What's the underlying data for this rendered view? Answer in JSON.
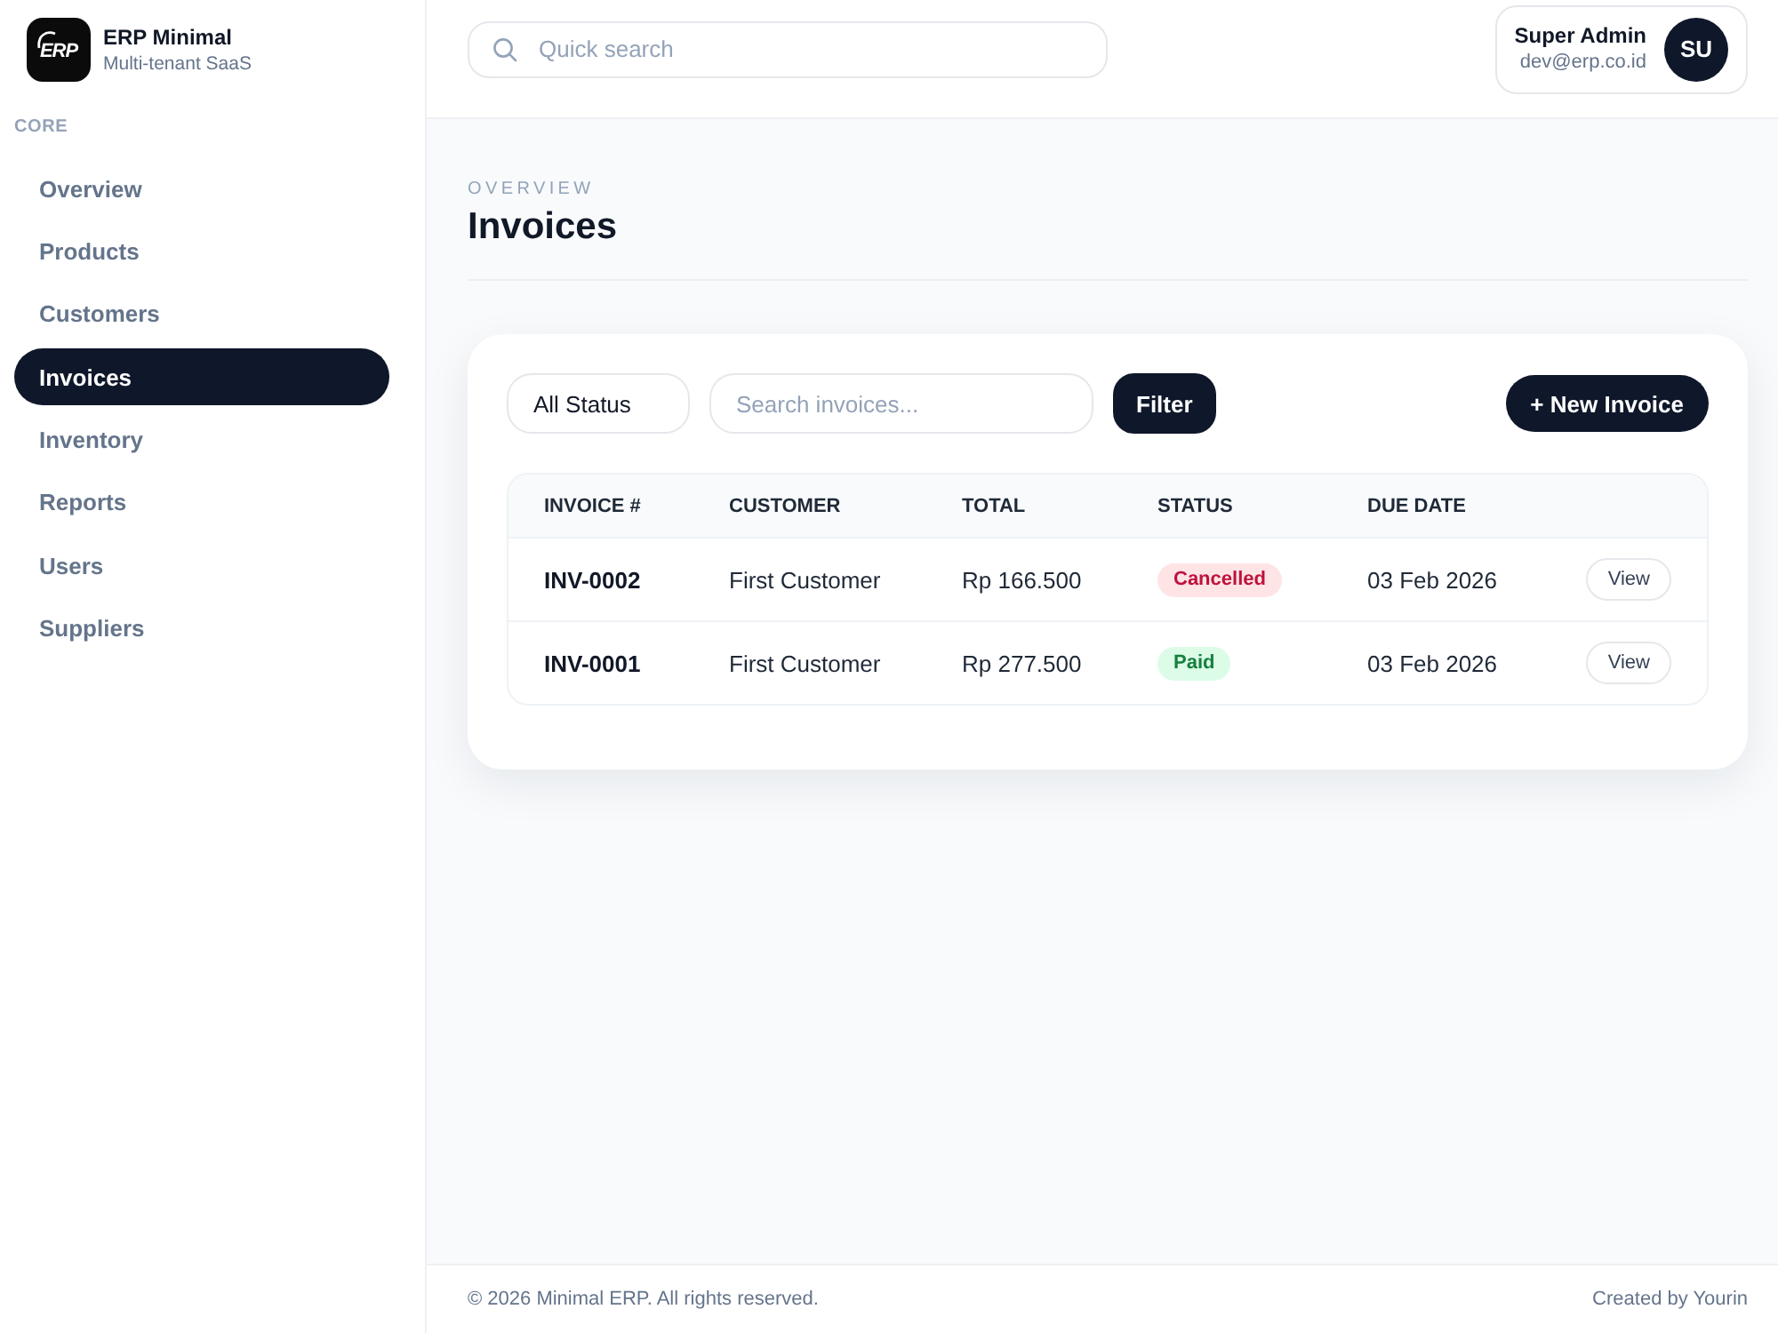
{
  "brand": {
    "logo_text": "ERP",
    "name": "ERP Minimal",
    "tagline": "Multi-tenant SaaS"
  },
  "sidebar": {
    "section": "CORE",
    "items": [
      {
        "label": "Overview",
        "selected": false
      },
      {
        "label": "Products",
        "selected": false
      },
      {
        "label": "Customers",
        "selected": false
      },
      {
        "label": "Invoices",
        "selected": true
      },
      {
        "label": "Inventory",
        "selected": false
      },
      {
        "label": "Reports",
        "selected": false
      },
      {
        "label": "Users",
        "selected": false
      },
      {
        "label": "Suppliers",
        "selected": false
      }
    ]
  },
  "topbar": {
    "search": {
      "placeholder": "Quick search"
    },
    "user": {
      "name": "Super Admin",
      "email": "dev@erp.co.id",
      "initials": "SU"
    }
  },
  "page": {
    "eyebrow": "OVERVIEW",
    "title": "Invoices"
  },
  "toolbar": {
    "status_filter": "All Status",
    "search": {
      "placeholder": "Search invoices..."
    },
    "filter_button": "Filter",
    "new_button": "+ New Invoice"
  },
  "table": {
    "columns": [
      "INVOICE #",
      "CUSTOMER",
      "TOTAL",
      "STATUS",
      "DUE DATE"
    ],
    "rows": [
      {
        "invoice": "INV-0002",
        "customer": "First Customer",
        "total": "Rp 166.500",
        "status": {
          "label": "Cancelled",
          "kind": "cancelled"
        },
        "due_date": "03 Feb 2026",
        "action": "View"
      },
      {
        "invoice": "INV-0001",
        "customer": "First Customer",
        "total": "Rp 277.500",
        "status": {
          "label": "Paid",
          "kind": "paid"
        },
        "due_date": "03 Feb 2026",
        "action": "View"
      }
    ]
  },
  "footer": {
    "copyright": "© 2026 Minimal ERP. All rights reserved.",
    "credit": "Created by Yourin"
  }
}
